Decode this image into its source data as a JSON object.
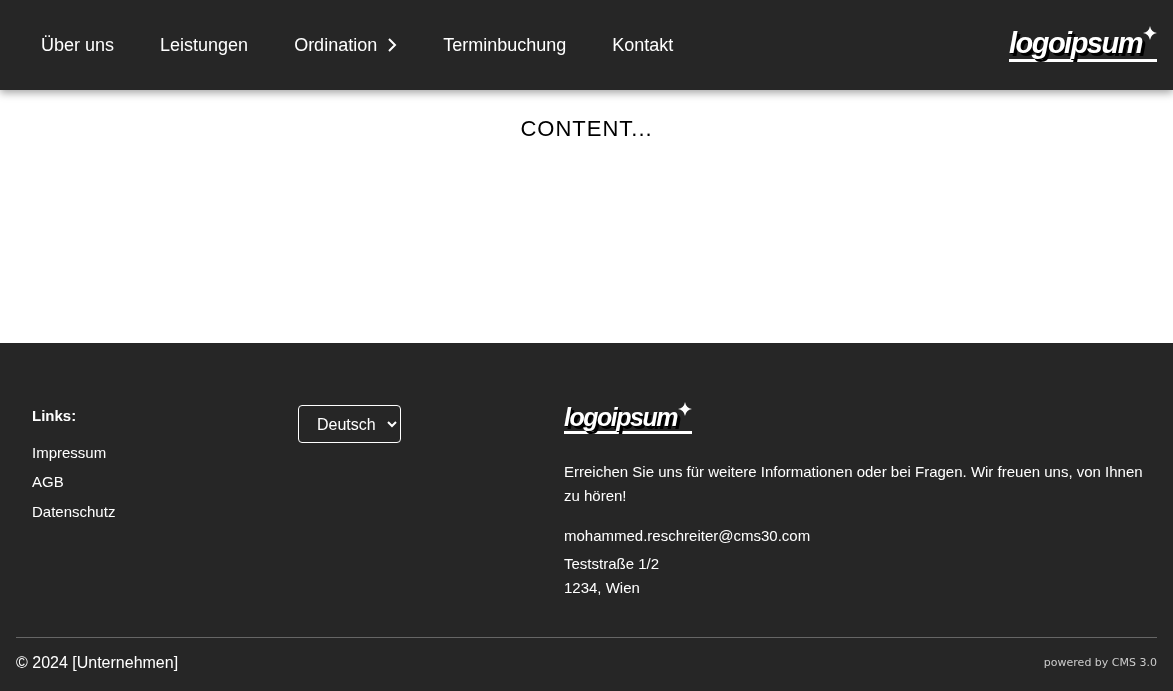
{
  "header": {
    "nav": [
      {
        "label": "Über uns",
        "kind": "link"
      },
      {
        "label": "Leistungen",
        "kind": "link"
      },
      {
        "label": "Ordination",
        "kind": "submenu"
      },
      {
        "label": "Terminbuchung",
        "kind": "link"
      },
      {
        "label": "Kontakt",
        "kind": "link"
      }
    ],
    "logo": "logoipsum"
  },
  "content": {
    "text": "CONTENT..."
  },
  "footer": {
    "links_title": "Links:",
    "links": [
      "Impressum",
      "AGB",
      "Datenschutz"
    ],
    "language_select": {
      "value": "Deutsch"
    },
    "logo": "logoipsum",
    "description": "Erreichen Sie uns für weitere Informationen oder bei Fragen. Wir freuen uns, von Ihnen zu hören!",
    "email": "mohammed.reschreiter@cms30.com",
    "address": [
      "Teststraße 1/2",
      "1234, Wien"
    ],
    "copyright": "© 2024 [Unternehmen]",
    "powered_by": "powered by CMS 3.0"
  }
}
